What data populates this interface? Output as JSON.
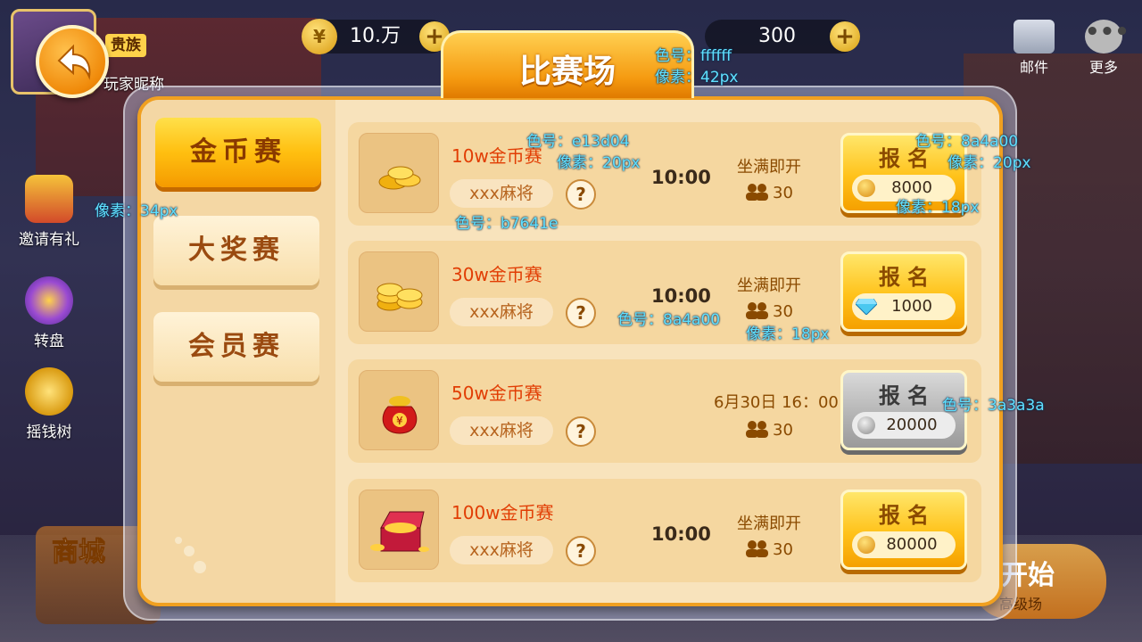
{
  "topbar": {
    "noble_badge": "贵族",
    "player_name": "玩家昵称",
    "gold_amount": "10.万",
    "gold_icon": "yen-coin-icon",
    "ticket_amount": "300",
    "plus_symbol": "+",
    "mail_label": "邮件",
    "more_label": "更多",
    "more_glyph": "•••"
  },
  "sidebar": {
    "items": [
      {
        "label": "邀请有礼",
        "icon": "gift-icon"
      },
      {
        "label": "转盘",
        "icon": "wheel-icon"
      },
      {
        "label": "摇钱树",
        "icon": "money-tree-icon"
      }
    ]
  },
  "bottom": {
    "shop_label": "商城",
    "start_label": "开始",
    "start_sub": "高级场"
  },
  "modal": {
    "title": "比赛场",
    "tabs": [
      {
        "label": "金币赛",
        "active": true
      },
      {
        "label": "大奖赛",
        "active": false
      },
      {
        "label": "会员赛",
        "active": false
      }
    ],
    "matches": [
      {
        "name": "10w金币赛",
        "tag": "xxx麻将",
        "help": "?",
        "time": "10:00",
        "status": "坐满即开",
        "players": "30",
        "signup_label": "报名",
        "price": "8000",
        "price_type": "coin",
        "enabled": true,
        "thumb": "coin-pile-icon"
      },
      {
        "name": "30w金币赛",
        "tag": "xxx麻将",
        "help": "?",
        "time": "10:00",
        "status": "坐满即开",
        "players": "30",
        "signup_label": "报名",
        "price": "1000",
        "price_type": "diamond",
        "enabled": true,
        "thumb": "coin-stack-icon"
      },
      {
        "name": "50w金币赛",
        "tag": "xxx麻将",
        "help": "?",
        "time": "6月30日 16：00",
        "status": "",
        "players": "30",
        "signup_label": "报名",
        "price": "20000",
        "price_type": "coin",
        "enabled": false,
        "thumb": "money-bag-icon"
      },
      {
        "name": "100w金币赛",
        "tag": "xxx麻将",
        "help": "?",
        "time": "10:00",
        "status": "坐满即开",
        "players": "30",
        "signup_label": "报名",
        "price": "80000",
        "price_type": "coin",
        "enabled": true,
        "thumb": "treasure-chest-icon"
      }
    ]
  },
  "annotations": [
    "色号：ffffff",
    "像素：42px",
    "色号：e13d04",
    "像素：20px",
    "色号：8a4a00",
    "像素：20px",
    "像素：34px",
    "色号：b7641e",
    "像素：18px",
    "色号：8a4a00",
    "像素：18px",
    "色号：3a3a3a"
  ],
  "colors": {
    "title": "#ffffff",
    "match_name": "#e13d04",
    "tag": "#b7641e",
    "accent_brown": "#8a4a00",
    "disabled_text": "#3a3a3a",
    "modal_border": "#f0a020"
  }
}
